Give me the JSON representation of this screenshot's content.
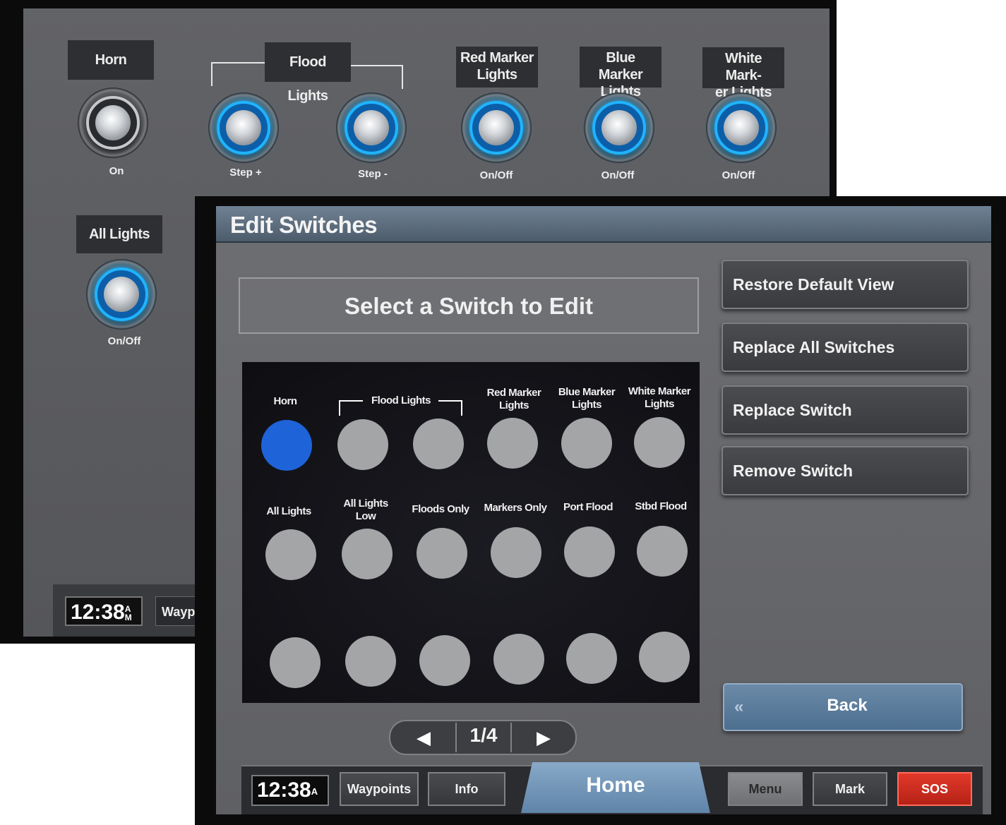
{
  "back_screen": {
    "switches": [
      {
        "label": "Horn",
        "sub": "On",
        "lit": false
      },
      {
        "label": "Flood Lights",
        "sub": "Step +",
        "lit": true
      },
      {
        "label": "",
        "sub": "Step -",
        "lit": true
      },
      {
        "label": "Red Marker Lights",
        "sub": "On/Off",
        "lit": true
      },
      {
        "label": "Blue Marker Lights",
        "sub": "On/Off",
        "lit": true
      },
      {
        "label": "White Mark-er Lights",
        "sub": "On/Off",
        "lit": true
      },
      {
        "label": "All Lights",
        "sub": "On/Off",
        "lit": true
      }
    ],
    "labels": {
      "horn": "Horn",
      "flood": "Flood Lights",
      "red_1": "Red Marker",
      "red_2": "Lights",
      "blue_1": "Blue Marker",
      "blue_2": "Lights",
      "white_1": "White Mark-",
      "white_2": "er Lights",
      "all": "All Lights"
    },
    "subs": {
      "horn": "On",
      "step_plus": "Step +",
      "step_minus": "Step -",
      "red": "On/Off",
      "blue": "On/Off",
      "white": "On/Off",
      "all": "On/Off"
    },
    "clock": {
      "time": "12:38",
      "ampm_1": "A",
      "ampm_2": "M"
    },
    "waypoints": "Waypoints"
  },
  "front_screen": {
    "title": "Edit Switches",
    "prompt": "Select a Switch to Edit",
    "actions": {
      "restore": "Restore Default View",
      "replace_all": "Replace All Switches",
      "replace": "Replace Switch",
      "remove": "Remove Switch"
    },
    "back": {
      "chevron": "«",
      "label": "Back"
    },
    "grid": {
      "row1": {
        "horn": "Horn",
        "flood": "Flood Lights",
        "red_1": "Red Marker",
        "red_2": "Lights",
        "blue_1": "Blue Marker",
        "blue_2": "Lights",
        "white_1": "White Marker",
        "white_2": "Lights"
      },
      "row2": {
        "all": "All Lights",
        "all_low_1": "All Lights",
        "all_low_2": "Low",
        "floods_only": "Floods Only",
        "markers_only": "Markers Only",
        "port_flood": "Port Flood",
        "stbd_flood": "Stbd Flood"
      },
      "selected": "Horn"
    },
    "pager": {
      "prev": "◀",
      "page": "1/4",
      "next": "▶"
    },
    "bottom": {
      "time": "12:38",
      "ampm": "A",
      "waypoints": "Waypoints",
      "info": "Info",
      "home": "Home",
      "menu": "Menu",
      "mark": "Mark",
      "sos": "SOS"
    }
  }
}
